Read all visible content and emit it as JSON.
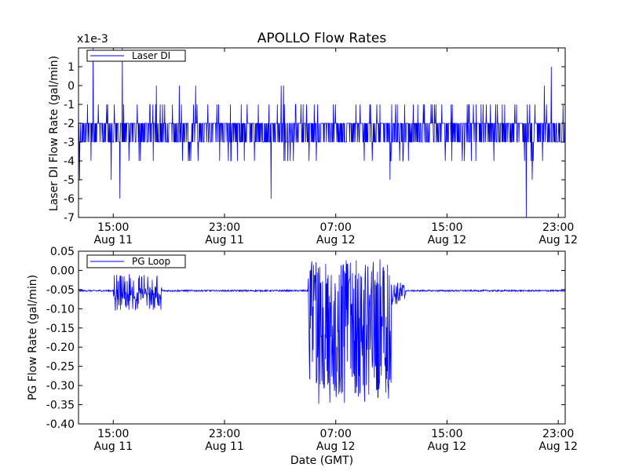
{
  "figure": {
    "title": "APOLLO Flow Rates",
    "line_color": "#0000ff"
  },
  "chart_data": [
    {
      "type": "line",
      "ylabel": "Laser DI Flow Rate (gal/min)",
      "xlabel": "",
      "offset_label": "x1e-3",
      "legend": "top-left",
      "grid": false,
      "x_ticks": [
        {
          "time": "15:00",
          "date": "Aug 11"
        },
        {
          "time": "23:00",
          "date": "Aug 11"
        },
        {
          "time": "07:00",
          "date": "Aug 12"
        },
        {
          "time": "15:00",
          "date": "Aug 12"
        },
        {
          "time": "23:00",
          "date": "Aug 12"
        }
      ],
      "xlim": [
        "Aug 11 12:30",
        "Aug 12 23:30"
      ],
      "ylim": [
        -7,
        2
      ],
      "y_ticks": [
        1,
        0,
        -1,
        -2,
        -3,
        -4,
        -5,
        -6,
        -7
      ],
      "y_tick_labels": [
        "1",
        "0",
        "-1",
        "-2",
        "-3",
        "-4",
        "-5",
        "-6",
        "-7"
      ],
      "series": [
        {
          "name": "Laser DI",
          "color": "#0000ff",
          "note_units": "x1e-3 gal/min",
          "typical_range": [
            -3,
            -2
          ],
          "spike_max": 2,
          "spike_min": -7
        }
      ]
    },
    {
      "type": "line",
      "ylabel": "PG Flow Rate (gal/min)",
      "xlabel": "Date (GMT)",
      "legend": "top-left",
      "grid": false,
      "x_ticks": [
        {
          "time": "15:00",
          "date": "Aug 11"
        },
        {
          "time": "23:00",
          "date": "Aug 11"
        },
        {
          "time": "07:00",
          "date": "Aug 12"
        },
        {
          "time": "15:00",
          "date": "Aug 12"
        },
        {
          "time": "23:00",
          "date": "Aug 12"
        }
      ],
      "xlim": [
        "Aug 11 12:30",
        "Aug 12 23:30"
      ],
      "ylim": [
        -0.4,
        0.05
      ],
      "y_ticks": [
        0.05,
        0.0,
        -0.05,
        -0.1,
        -0.15,
        -0.2,
        -0.25,
        -0.3,
        -0.35,
        -0.4
      ],
      "y_tick_labels": [
        "0.05",
        "0.00",
        "-0.05",
        "-0.10",
        "-0.15",
        "-0.20",
        "-0.25",
        "-0.30",
        "-0.35",
        "-0.40"
      ],
      "series": [
        {
          "name": "PG Loop",
          "color": "#0000ff",
          "baseline": -0.053,
          "segments": [
            {
              "start": "Aug 11 12:30",
              "end": "Aug 11 15:00",
              "center": -0.053,
              "amplitude": 0.002
            },
            {
              "start": "Aug 11 15:00",
              "end": "Aug 11 18:30",
              "center": -0.06,
              "amplitude": 0.02,
              "min": -0.105,
              "max": -0.01
            },
            {
              "start": "Aug 11 18:30",
              "end": "Aug 12 05:00",
              "center": -0.053,
              "amplitude": 0.002
            },
            {
              "start": "Aug 12 05:00",
              "end": "Aug 12 11:00",
              "center": -0.15,
              "amplitude": 0.18,
              "min": -0.355,
              "max": 0.03
            },
            {
              "start": "Aug 12 11:00",
              "end": "Aug 12 12:00",
              "center": -0.06,
              "amplitude": 0.03
            },
            {
              "start": "Aug 12 12:00",
              "end": "Aug 12 23:30",
              "center": -0.053,
              "amplitude": 0.002
            }
          ]
        }
      ]
    }
  ]
}
